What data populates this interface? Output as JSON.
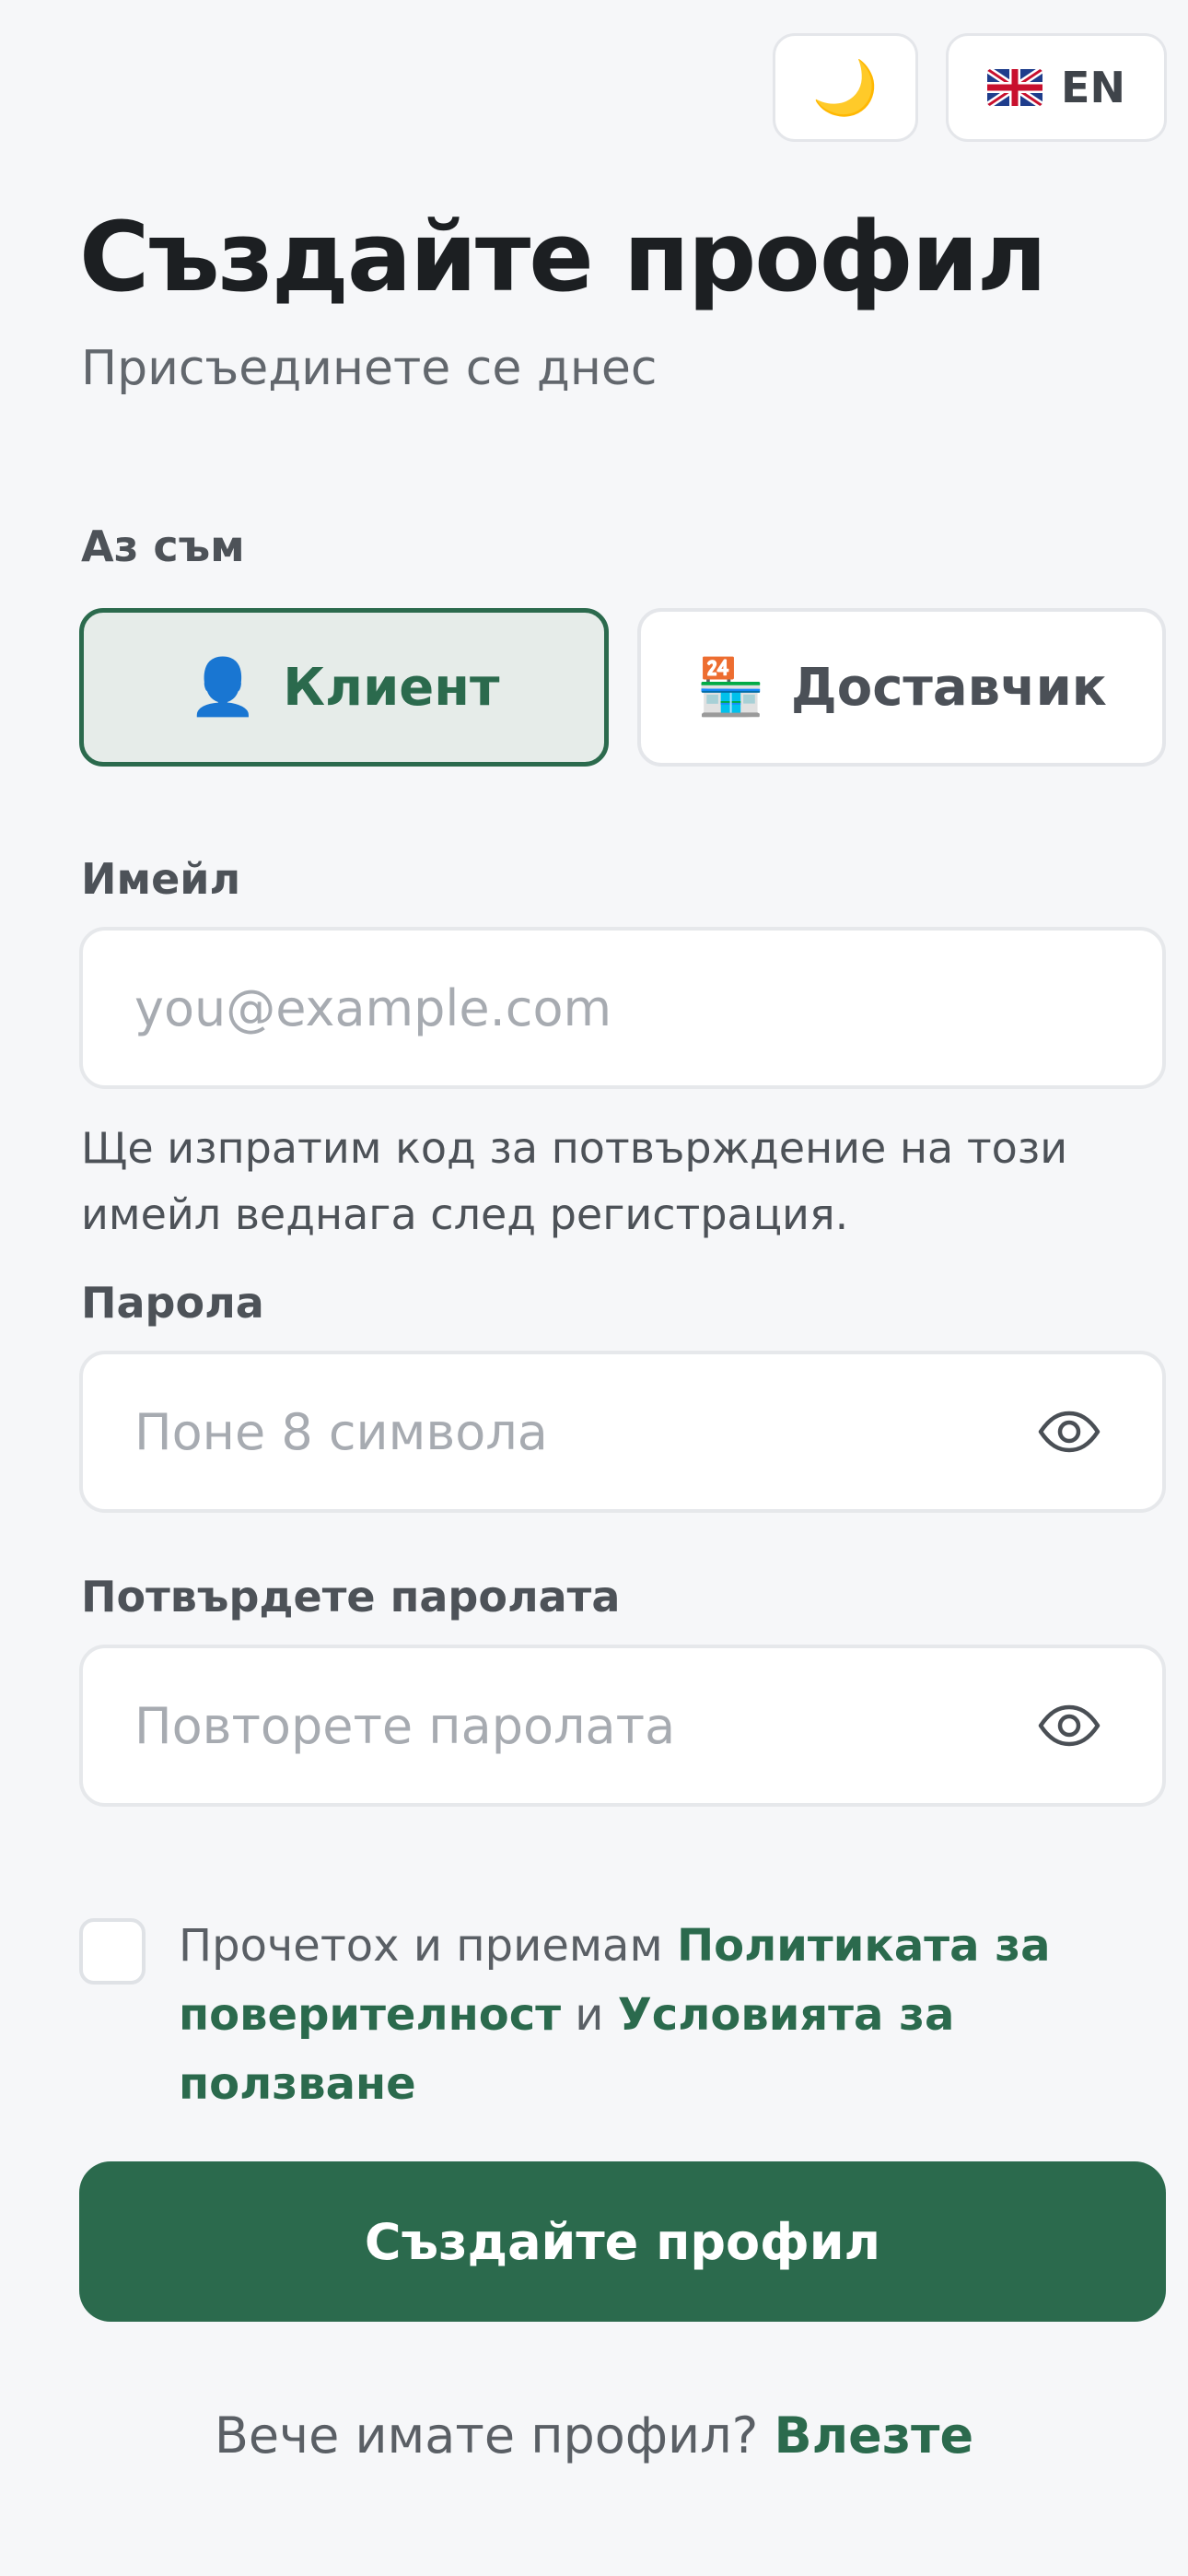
{
  "top_controls": {
    "theme_icon": "🌙",
    "language_flag": "uk-flag",
    "language_label": "EN"
  },
  "header": {
    "title": "Създайте профил",
    "subtitle": "Присъединете се днес"
  },
  "role": {
    "label": "Аз съм",
    "options": [
      {
        "icon": "👤",
        "label": "Клиент",
        "selected": true
      },
      {
        "icon": "🏪",
        "label": "Доставчик",
        "selected": false
      }
    ]
  },
  "email": {
    "label": "Имейл",
    "placeholder": "you@example.com",
    "value": "",
    "hint": "Ще изпратим код за потвърждение на този имейл веднага след регистрация."
  },
  "password": {
    "label": "Парола",
    "placeholder": "Поне 8 символа",
    "value": ""
  },
  "confirm_password": {
    "label": "Потвърдете паролата",
    "placeholder": "Повторете паролата",
    "value": ""
  },
  "terms": {
    "checked": false,
    "prefix": "Прочетох и приемам ",
    "privacy_link": "Политиката за поверителност",
    "conjunction": " и ",
    "terms_link": "Условията за ползване"
  },
  "submit_label": "Създайте профил",
  "login": {
    "prompt": "Вече имате профил?",
    "link": "Влезте"
  },
  "colors": {
    "accent": "#2b6a4d",
    "background": "#f6f7f9",
    "selected_bg": "#e6ece9"
  }
}
